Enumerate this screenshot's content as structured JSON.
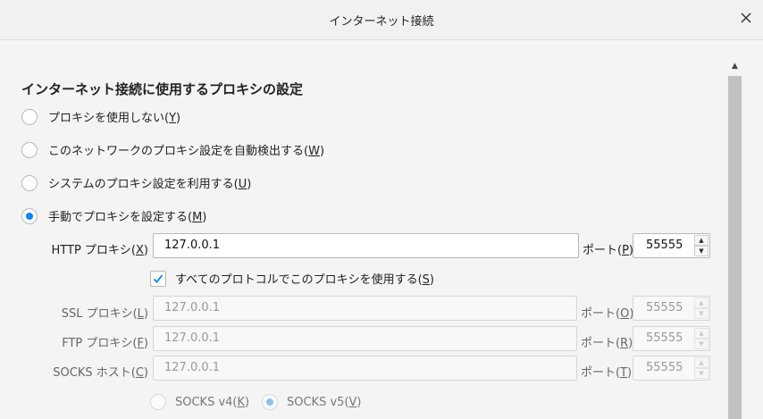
{
  "window": {
    "title": "インターネット接続",
    "close_icon": "close-icon"
  },
  "heading": "インターネット接続に使用するプロキシの設定",
  "proxy_options": [
    {
      "label": "プロキシを使用しない(",
      "key": "Y",
      "suffix": ")",
      "checked": false
    },
    {
      "label": "このネットワークのプロキシ設定を自動検出する(",
      "key": "W",
      "suffix": ")",
      "checked": false
    },
    {
      "label": "システムのプロキシ設定を利用する(",
      "key": "U",
      "suffix": ")",
      "checked": false
    },
    {
      "label": "手動でプロキシを設定する(",
      "key": "M",
      "suffix": ")",
      "checked": true
    }
  ],
  "http": {
    "label_pre": "HTTP プロキシ(",
    "label_key": "X",
    "label_post": ")",
    "value": "127.0.0.1",
    "port_pre": "ポート(",
    "port_key": "P",
    "port_post": ")",
    "port": "55555"
  },
  "share_all": {
    "label_pre": "すべてのプロトコルでこのプロキシを使用する(",
    "key": "S",
    "label_post": ")",
    "checked": true
  },
  "ssl": {
    "label_pre": "SSL プロキシ(",
    "label_key": "L",
    "label_post": ")",
    "value": "127.0.0.1",
    "port_pre": "ポート(",
    "port_key": "O",
    "port_post": ")",
    "port": "55555"
  },
  "ftp": {
    "label_pre": "FTP プロキシ(",
    "label_key": "F",
    "label_post": ")",
    "value": "127.0.0.1",
    "port_pre": "ポート(",
    "port_key": "R",
    "port_post": ")",
    "port": "55555"
  },
  "socks": {
    "label_pre": "SOCKS ホスト(",
    "label_key": "C",
    "label_post": ")",
    "value": "127.0.0.1",
    "port_pre": "ポート(",
    "port_key": "T",
    "port_post": ")",
    "port": "55555"
  },
  "socks_version": [
    {
      "label_pre": "SOCKS v4(",
      "key": "K",
      "label_post": ")",
      "checked": false
    },
    {
      "label_pre": "SOCKS v5(",
      "key": "V",
      "label_post": ")",
      "checked": true
    }
  ],
  "colors": {
    "accent": "#0a84ff",
    "disabled_accent": "#8fc3ee"
  }
}
